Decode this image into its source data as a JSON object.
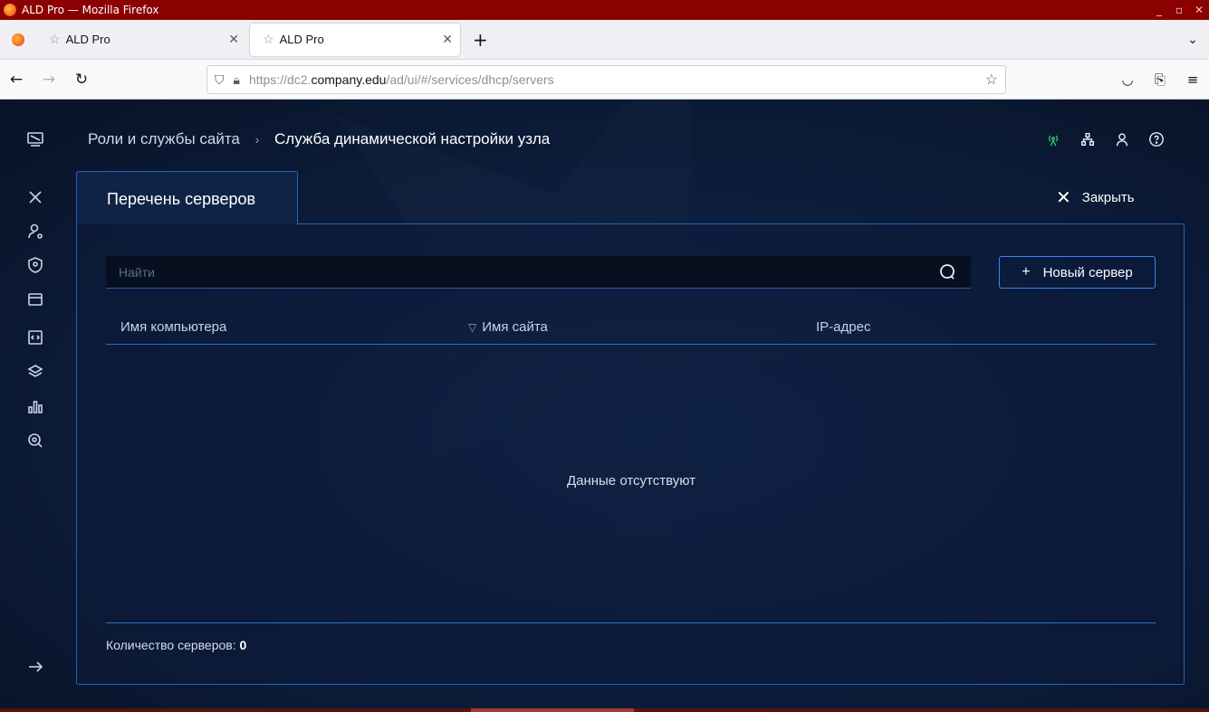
{
  "window": {
    "title": "ALD Pro — Mozilla Firefox",
    "controls": [
      "_",
      "▫",
      "✕"
    ]
  },
  "tabs": [
    {
      "label": "ALD Pro",
      "active": false
    },
    {
      "label": "ALD Pro",
      "active": true
    }
  ],
  "urlbar": {
    "prefix": "https://dc2.",
    "domain": "company.edu",
    "path": "/ad/ui/#/services/dhcp/servers"
  },
  "breadcrumb": {
    "parent": "Роли и службы сайта",
    "separator": "›",
    "current": "Служба динамической настройки узла"
  },
  "panel": {
    "tab_title": "Перечень серверов",
    "close_label": "Закрыть",
    "search_placeholder": "Найти",
    "new_button_label": "Новый сервер",
    "columns": [
      "Имя компьютера",
      "Имя сайта",
      "IP-адрес"
    ],
    "empty_text": "Данные отсутствуют",
    "count_label": "Количество серверов:",
    "count_value": "0"
  },
  "colors": {
    "accent": "#1f64b8",
    "background": "#0b1a33",
    "titlebar": "#8b0000",
    "status_ok": "#22c55e"
  }
}
